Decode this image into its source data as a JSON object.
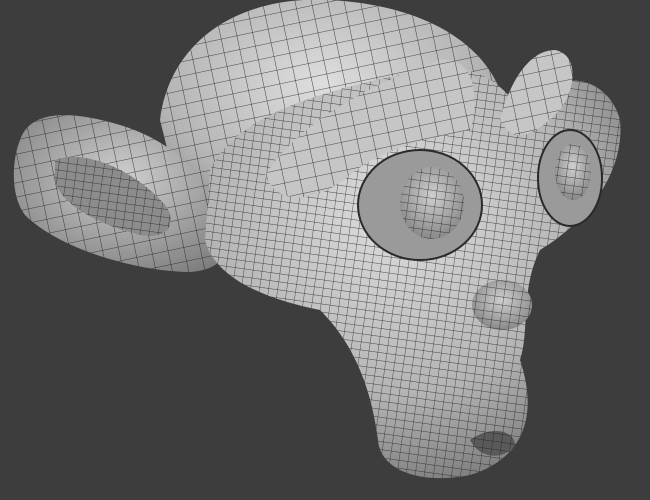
{
  "viewport": {
    "background": "#3d3d3d",
    "mesh_fill_light": "#d2d2d2",
    "mesh_fill_dark": "#7a7a7a",
    "wire_color": "#1e1e1e",
    "object": "monkey-head-mesh"
  }
}
